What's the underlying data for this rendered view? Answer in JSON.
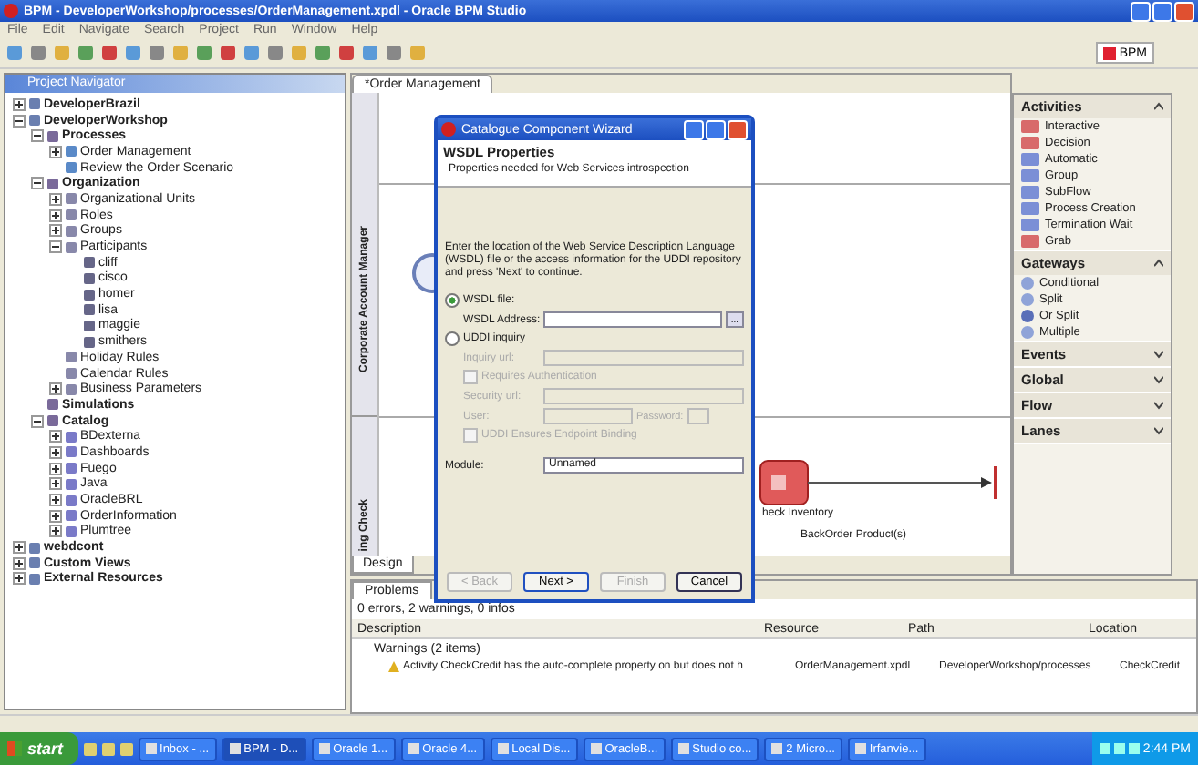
{
  "window": {
    "title": "BPM - DeveloperWorkshop/processes/OrderManagement.xpdl - Oracle BPM Studio"
  },
  "menu": [
    "File",
    "Edit",
    "Navigate",
    "Search",
    "Project",
    "Run",
    "Window",
    "Help"
  ],
  "perspective": {
    "label": "BPM"
  },
  "navigator": {
    "title": "Project Navigator",
    "tree": [
      {
        "label": "DeveloperBrazil",
        "kind": "project",
        "expanded": false
      },
      {
        "label": "DeveloperWorkshop",
        "kind": "project",
        "expanded": true,
        "children": [
          {
            "label": "Processes",
            "kind": "folder",
            "expanded": true,
            "children": [
              {
                "label": "Order Management",
                "kind": "process",
                "expanded": false
              },
              {
                "label": "Review the Order Scenario",
                "kind": "process"
              }
            ]
          },
          {
            "label": "Organization",
            "kind": "folder",
            "expanded": true,
            "children": [
              {
                "label": "Organizational Units",
                "kind": "item",
                "expanded": false
              },
              {
                "label": "Roles",
                "kind": "item",
                "expanded": false
              },
              {
                "label": "Groups",
                "kind": "item",
                "expanded": false
              },
              {
                "label": "Participants",
                "kind": "item",
                "expanded": true,
                "children": [
                  {
                    "label": "cliff",
                    "kind": "person"
                  },
                  {
                    "label": "cisco",
                    "kind": "person"
                  },
                  {
                    "label": "homer",
                    "kind": "person"
                  },
                  {
                    "label": "lisa",
                    "kind": "person"
                  },
                  {
                    "label": "maggie",
                    "kind": "person"
                  },
                  {
                    "label": "smithers",
                    "kind": "person"
                  }
                ]
              },
              {
                "label": "Holiday Rules",
                "kind": "item"
              },
              {
                "label": "Calendar Rules",
                "kind": "item"
              },
              {
                "label": "Business Parameters",
                "kind": "item",
                "expanded": false
              }
            ]
          },
          {
            "label": "Simulations",
            "kind": "folder"
          },
          {
            "label": "Catalog",
            "kind": "folder",
            "expanded": true,
            "children": [
              {
                "label": "BDexterna",
                "kind": "module",
                "expanded": false
              },
              {
                "label": "Dashboards",
                "kind": "module",
                "expanded": false
              },
              {
                "label": "Fuego",
                "kind": "module",
                "expanded": false
              },
              {
                "label": "Java",
                "kind": "module",
                "expanded": false
              },
              {
                "label": "OracleBRL",
                "kind": "module",
                "expanded": false
              },
              {
                "label": "OrderInformation",
                "kind": "module",
                "expanded": false
              },
              {
                "label": "Plumtree",
                "kind": "module",
                "expanded": false
              }
            ]
          }
        ]
      },
      {
        "label": "webdcont",
        "kind": "project",
        "expanded": false
      },
      {
        "label": "Custom Views",
        "kind": "project",
        "expanded": false
      },
      {
        "label": "External Resources",
        "kind": "project",
        "expanded": false
      }
    ]
  },
  "editor": {
    "tab": "*Order Management",
    "lanes": [
      "Corporate Account Manager",
      "ing Check"
    ],
    "activity": "heck Inventory",
    "transition": "BackOrder Product(s)",
    "bottom_tabs": [
      "Design"
    ]
  },
  "palette": [
    {
      "title": "Activities",
      "expanded": true,
      "items": [
        {
          "label": "Interactive",
          "color": "#d86a6a"
        },
        {
          "label": "Decision",
          "color": "#d86a6a"
        },
        {
          "label": "Automatic",
          "color": "#7b8fd6"
        },
        {
          "label": "Group",
          "color": "#7b8fd6"
        },
        {
          "label": "SubFlow",
          "color": "#7b8fd6"
        },
        {
          "label": "Process Creation",
          "color": "#7b8fd6"
        },
        {
          "label": "Termination Wait",
          "color": "#7b8fd6"
        },
        {
          "label": "Grab",
          "color": "#d86a6a"
        }
      ]
    },
    {
      "title": "Gateways",
      "expanded": true,
      "items": [
        {
          "label": "Conditional",
          "color": "#8fa3d8"
        },
        {
          "label": "Split",
          "color": "#8fa3d8"
        },
        {
          "label": "Or Split",
          "color": "#5a6fb8"
        },
        {
          "label": "Multiple",
          "color": "#8fa3d8"
        }
      ]
    },
    {
      "title": "Events",
      "expanded": false
    },
    {
      "title": "Global",
      "expanded": false
    },
    {
      "title": "Flow",
      "expanded": false
    },
    {
      "title": "Lanes",
      "expanded": false
    }
  ],
  "dialog": {
    "title": "Catalogue Component Wizard",
    "heading": "WSDL Properties",
    "subtitle": "Properties needed for Web Services introspection",
    "instructions": "Enter the location of the Web Service Description Language (WSDL) file or the access information for the UDDI repository and press 'Next' to continue.",
    "options": [
      {
        "label": "WSDL file:",
        "selected": true
      },
      {
        "label": "UDDI inquiry",
        "selected": false
      }
    ],
    "wsdl_address_label": "WSDL Address:",
    "browse": "...",
    "inquiry_url_label": "Inquiry url:",
    "auth_label": "Requires Authentication",
    "auth_checked": false,
    "binding_checked": false,
    "security_url_label": "Security url:",
    "user_label": "User:",
    "password_label": "Password:",
    "binding_label": "UDDI Ensures Endpoint Binding",
    "module_label": "Module:",
    "module_value": "Unnamed",
    "buttons": [
      {
        "label": "< Back",
        "disabled": true
      },
      {
        "label": "Next >",
        "disabled": false
      },
      {
        "label": "Finish",
        "disabled": true
      },
      {
        "label": "Cancel",
        "disabled": false
      }
    ]
  },
  "problems": {
    "tab": "Problems",
    "summary": "0 errors, 2 warnings, 0 infos",
    "columns": [
      "Description",
      "Resource",
      "Path",
      "Location"
    ],
    "group": "Warnings (2 items)",
    "rows": [
      {
        "description": "Activity CheckCredit has the auto-complete property on but does not h",
        "resource": "OrderManagement.xpdl",
        "path": "DeveloperWorkshop/processes",
        "location": "CheckCredit"
      }
    ]
  },
  "taskbar": {
    "start": "start",
    "items": [
      "Inbox - ...",
      "BPM - D...",
      "Oracle 1...",
      "Oracle 4...",
      "Local Dis...",
      "OracleB...",
      "Studio co...",
      "2 Micro...",
      "Irfanvie..."
    ],
    "clock": "2:44 PM"
  }
}
